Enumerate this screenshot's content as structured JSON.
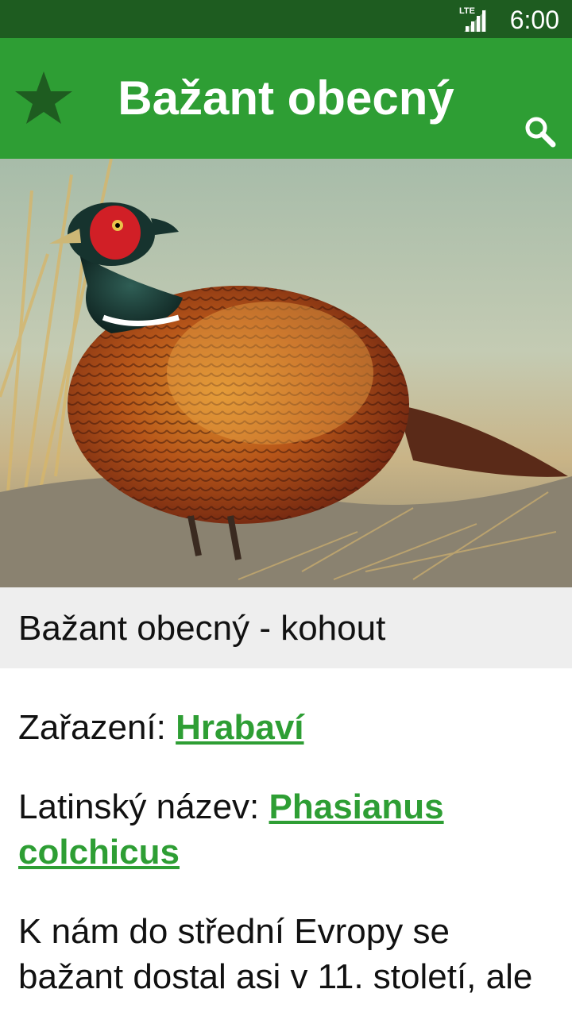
{
  "status_bar": {
    "network_label": "LTE",
    "time": "6:00"
  },
  "app_bar": {
    "title": "Bažant obecný",
    "favorite_icon": "star-icon",
    "search_icon": "search-icon",
    "accent_color": "#2e9e34",
    "status_color": "#1e5c20"
  },
  "photo": {
    "caption": "Bažant obecný - kohout"
  },
  "details": {
    "classification_label": "Zařazení:",
    "classification_value": "Hrabaví",
    "latin_label": "Latinský název:",
    "latin_value": "Phasianus colchicus",
    "description": "K nám do střední Evropy se bažant dostal asi v 11. století, ale"
  }
}
